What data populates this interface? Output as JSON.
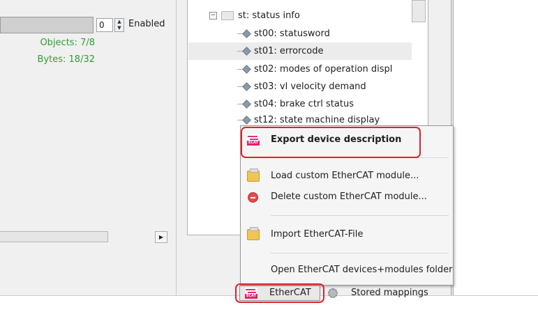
{
  "left_panel": {
    "value_field": "0",
    "enabled_label": "Enabled",
    "objects_text": "Objects: 7/8",
    "bytes_text": "Bytes: 18/32"
  },
  "tree": {
    "group_label": "st: status info",
    "items": [
      {
        "label": "st00: statusword"
      },
      {
        "label": "st01: errorcode"
      },
      {
        "label": "st02: modes of operation displ"
      },
      {
        "label": "st03: vl velocity demand"
      },
      {
        "label": "st04: brake ctrl status"
      },
      {
        "label": "st12: state machine display"
      }
    ]
  },
  "context_menu": {
    "items": [
      {
        "label": "Export device description",
        "icon": "ethercat-icon"
      },
      {
        "label": "Load custom EtherCAT module...",
        "icon": "open-folder-icon"
      },
      {
        "label": "Delete custom EtherCAT module...",
        "icon": "delete-icon"
      },
      {
        "label": "Import EtherCAT-File",
        "icon": "open-folder-icon"
      },
      {
        "label": "Open EtherCAT devices+modules folder",
        "icon": ""
      }
    ]
  },
  "bottom_tabs": {
    "ethercat_label": "EtherCAT",
    "stored_label": "Stored mappings"
  },
  "colors": {
    "stat_green": "#2f9d34",
    "highlight_red": "#e0202a",
    "ethercat_pink": "#e6206e"
  },
  "icons": {
    "ecat_badge_text": "ECAT"
  }
}
